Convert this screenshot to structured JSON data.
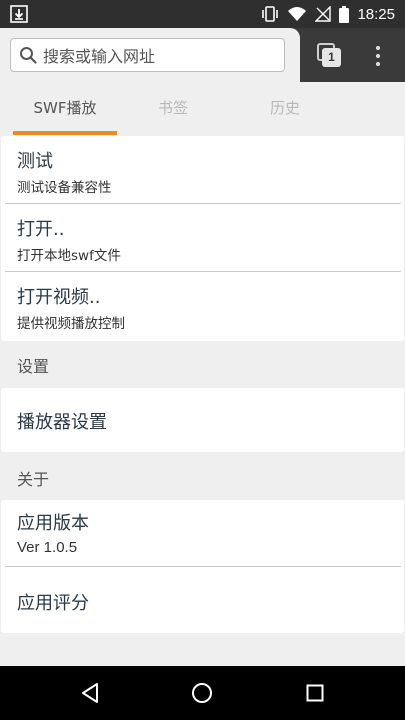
{
  "status_bar": {
    "time": "18:25",
    "icons": [
      "download-icon",
      "vibrate-icon",
      "wifi-icon",
      "no-signal-icon",
      "battery-icon"
    ]
  },
  "toolbar": {
    "search_placeholder": "搜索或输入网址",
    "tab_count": "1"
  },
  "tabs": [
    {
      "label": "SWF播放",
      "active": true
    },
    {
      "label": "书签",
      "active": false
    },
    {
      "label": "历史",
      "active": false
    }
  ],
  "main_list": [
    {
      "title": "测试",
      "subtitle": "测试设备兼容性"
    },
    {
      "title": "打开..",
      "subtitle": "打开本地swf文件"
    },
    {
      "title": "打开视频..",
      "subtitle": "提供视频播放控制"
    }
  ],
  "settings": {
    "header": "设置",
    "items": [
      {
        "title": "播放器设置"
      }
    ]
  },
  "about": {
    "header": "关于",
    "items": [
      {
        "title": "应用版本",
        "subtitle": "Ver 1.0.5"
      },
      {
        "title": "应用评分"
      }
    ]
  },
  "colors": {
    "accent": "#ef8a1e",
    "toolbar_bg": "#3a3a3a",
    "page_bg": "#efefef"
  }
}
